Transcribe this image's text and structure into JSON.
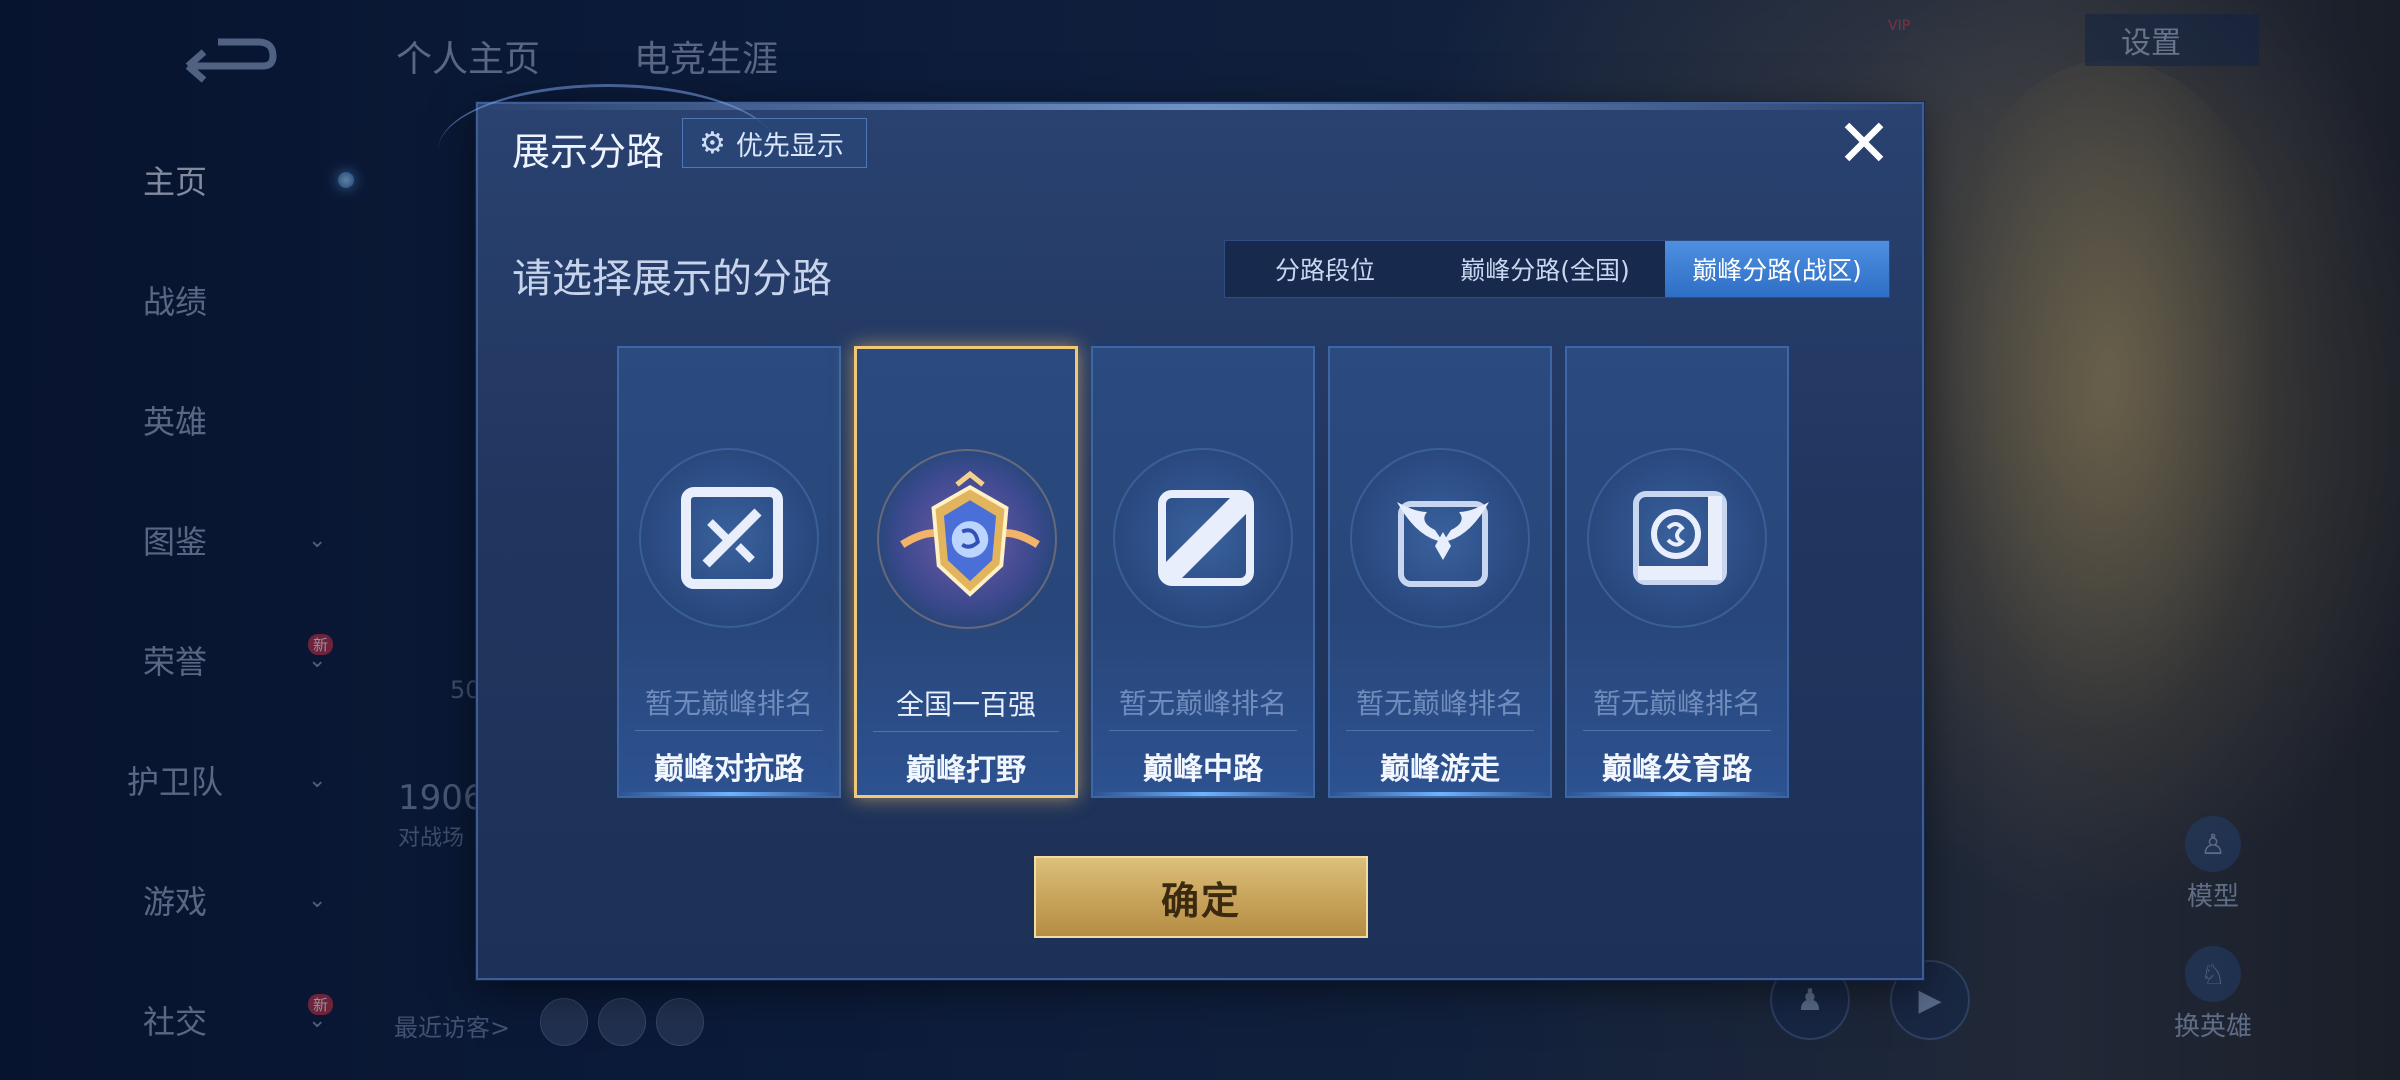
{
  "background": {
    "top_tabs": [
      "个人主页",
      "电竞生涯"
    ],
    "settings_label": "设置",
    "vip_badge": "VIP",
    "recent_visitors_label": "最近访客>",
    "right_buttons": [
      "模型",
      "换英雄"
    ],
    "left_nav": [
      {
        "label": "主页",
        "active": true
      },
      {
        "label": "战绩"
      },
      {
        "label": "英雄"
      },
      {
        "label": "图鉴",
        "chevron": true
      },
      {
        "label": "荣誉",
        "chevron": true,
        "badge": "新"
      },
      {
        "label": "护卫队",
        "chevron": true
      },
      {
        "label": "游戏",
        "chevron": true
      },
      {
        "label": "社交",
        "chevron": true,
        "badge": "新"
      }
    ],
    "partial_numbers": [
      "1906",
      "50"
    ],
    "partial_text": [
      "对战场"
    ]
  },
  "dialog": {
    "title": "展示分路",
    "priority_button": "优先显示",
    "close_icon": "close-icon",
    "subtitle": "请选择展示的分路",
    "segments": [
      {
        "label": "分路段位",
        "active": false
      },
      {
        "label": "巅峰分路(全国)",
        "active": false
      },
      {
        "label": "巅峰分路(战区)",
        "active": true
      }
    ],
    "lanes": [
      {
        "name": "巅峰对抗路",
        "rank": "暂无巅峰排名",
        "icon": "sword-lane-icon",
        "selected": false
      },
      {
        "name": "巅峰打野",
        "rank": "全国一百强",
        "icon": "jungle-rank-badge-icon",
        "selected": true
      },
      {
        "name": "巅峰中路",
        "rank": "暂无巅峰排名",
        "icon": "mid-lane-icon",
        "selected": false
      },
      {
        "name": "巅峰游走",
        "rank": "暂无巅峰排名",
        "icon": "roam-wings-icon",
        "selected": false
      },
      {
        "name": "巅峰发育路",
        "rank": "暂无巅峰排名",
        "icon": "farm-lane-icon",
        "selected": false
      }
    ],
    "confirm_button": "确定"
  },
  "colors": {
    "accent_gold": "#f0c879",
    "active_segment": "#3a7fd6",
    "dialog_bg": "#22385f"
  }
}
